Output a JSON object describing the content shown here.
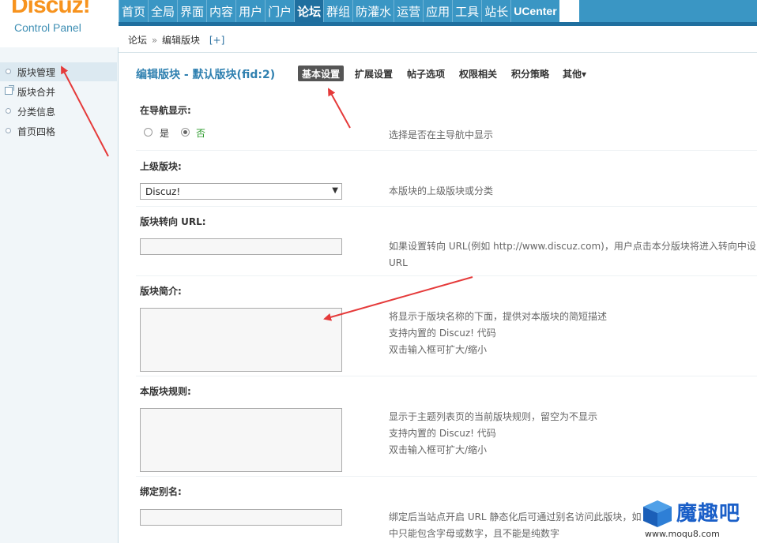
{
  "logo": {
    "brand": "Discuz!",
    "subtitle": "Control Panel"
  },
  "topnav": [
    "首页",
    "全局",
    "界面",
    "内容",
    "用户",
    "门户",
    "论坛",
    "群组",
    "防灌水",
    "运营",
    "应用",
    "工具",
    "站长",
    "UCenter"
  ],
  "topnav_active": "论坛",
  "breadcrumb": {
    "root": "论坛",
    "sep": "»",
    "current": "编辑版块",
    "plus": "[+]"
  },
  "sidebar": [
    {
      "label": "版块管理",
      "active": true
    },
    {
      "label": "版块合并",
      "active": false
    },
    {
      "label": "分类信息",
      "active": false
    },
    {
      "label": "首页四格",
      "active": false
    }
  ],
  "page_title": "编辑版块 - 默认版块(fid:2)",
  "tabs": [
    "基本设置",
    "扩展设置",
    "帖子选项",
    "权限相关",
    "积分策略",
    "其他▾"
  ],
  "fields": {
    "nav": {
      "label": "在导航显示:",
      "yes": "是",
      "no": "否",
      "value": "否",
      "tip": "选择是否在主导航中显示"
    },
    "parent": {
      "label": "上级版块:",
      "value": "Discuz!",
      "caret": "▼",
      "tip": "本版块的上级版块或分类"
    },
    "redirect": {
      "label": "版块转向 URL:",
      "tip1": "如果设置转向 URL(例如 http://www.discuz.com)，用户点击本分版块将进入转向中设",
      "tip2": "URL"
    },
    "intro": {
      "label": "版块简介:",
      "tip1": "将显示于版块名称的下面，提供对本版块的简短描述",
      "tip2": "支持内置的 Discuz! 代码",
      "tip3": "双击输入框可扩大/缩小"
    },
    "rules": {
      "label": "本版块规则:",
      "tip1": "显示于主题列表页的当前版块规则，留空为不显示",
      "tip2": "支持内置的 Discuz! 代码",
      "tip3": "双击输入框可扩大/缩小"
    },
    "alias": {
      "label": "绑定别名:",
      "tip1": "绑定后当站点开启 URL 静态化后可通过别名访问此版块，如",
      "tip2": "中只能包含字母或数字，且不能是纯数字"
    }
  },
  "watermark": {
    "text": "魔趣吧",
    "url": "www.moqu8.com"
  },
  "colors": {
    "nav_bg": "#3a96c4",
    "nav_active": "#1f6f9f",
    "title": "#2f80b0",
    "brand": "#f7931e",
    "arrow": "#e53a3a"
  }
}
